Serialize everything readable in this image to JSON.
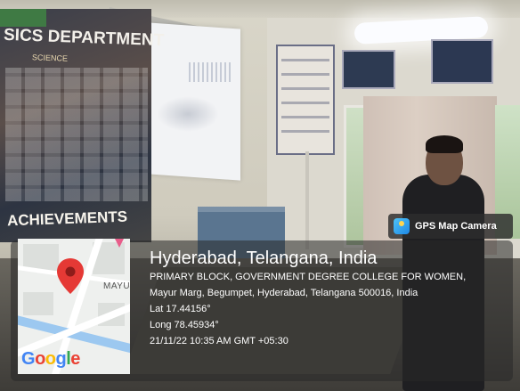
{
  "poster": {
    "title": "SICS DEPARTMENT",
    "subtitle": "SCIENCE",
    "footer": "ACHIEVEMENTS"
  },
  "gps_badge": {
    "label": "GPS Map Camera",
    "icon": "gps-map-camera-icon"
  },
  "map": {
    "area_label": "MAYU",
    "brand": "Google",
    "brand_colors": [
      "#4285F4",
      "#EA4335",
      "#FBBC05",
      "#4285F4",
      "#34A853",
      "#EA4335"
    ],
    "pin_color": "#E53935"
  },
  "location": {
    "city": "Hyderabad, Telangana, India",
    "place": "PRIMARY BLOCK, GOVERNMENT DEGREE COLLEGE FOR WOMEN,",
    "address": "Mayur Marg, Begumpet, Hyderabad, Telangana 500016, India",
    "lat": "Lat 17.44156°",
    "long": "Long 78.45934°",
    "timestamp": "21/11/22 10:35 AM GMT +05:30"
  }
}
